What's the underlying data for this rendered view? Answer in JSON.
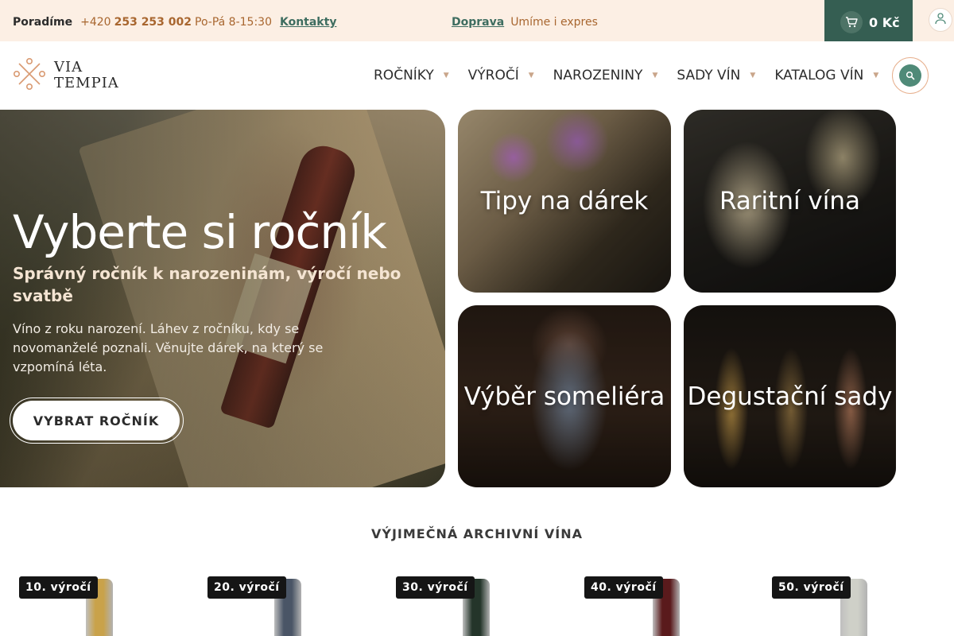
{
  "topbar": {
    "advise_label": "Poradíme",
    "phone_prefix": "+420",
    "phone_number": "253 253 002",
    "hours": "Po-Pá 8-15:30",
    "contacts_link": "Kontakty",
    "shipping_link": "Doprava",
    "shipping_text": "Umíme i expres",
    "cart_total": "0 Kč"
  },
  "brand": {
    "line1": "VIA",
    "line2": "TEMPIA",
    "accent_color": "#355e52",
    "highlight_color": "#a8662f"
  },
  "nav": {
    "items": [
      {
        "label": "ROČNÍKY"
      },
      {
        "label": "VÝROČÍ"
      },
      {
        "label": "NAROZENINY"
      },
      {
        "label": "SADY VÍN"
      },
      {
        "label": "KATALOG VÍN"
      }
    ]
  },
  "hero": {
    "title": "Vyberte si ročník",
    "subtitle": "Správný ročník k narozeninám, výročí nebo svatbě",
    "text": "Víno z roku narození. Láhev z ročníku, kdy se novomanželé poznali. Věnujte dárek, na který se vzpomíná léta.",
    "button": "VYBRAT ROČNÍK"
  },
  "categories": [
    {
      "label": "Tipy na dárek"
    },
    {
      "label": "Raritní vína"
    },
    {
      "label": "Výběr someliéra"
    },
    {
      "label": "Degustační sady"
    }
  ],
  "section": {
    "title": "VÝJIMEČNÁ ARCHIVNÍ VÍNA"
  },
  "products": [
    {
      "badge": "10. výročí",
      "neck_color": "#c9a24a"
    },
    {
      "badge": "20. výročí",
      "neck_color": "#4a5566"
    },
    {
      "badge": "30. výročí",
      "neck_color": "#24352a"
    },
    {
      "badge": "40. výročí",
      "neck_color": "#5a1a1c"
    },
    {
      "badge": "50. výročí",
      "neck_color": "#cfd0c8"
    }
  ]
}
